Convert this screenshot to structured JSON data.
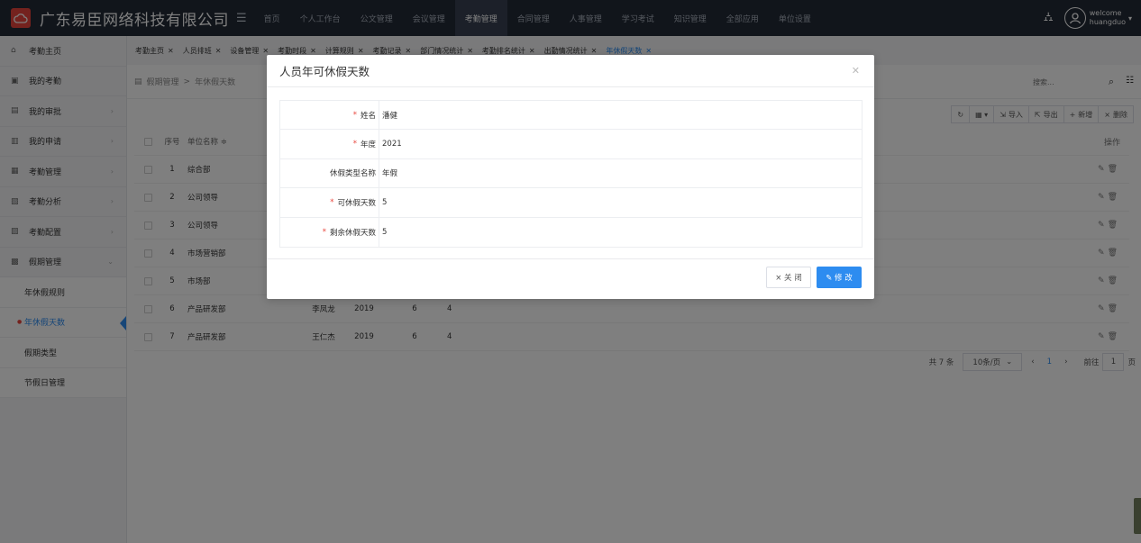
{
  "app": {
    "brand": "广东易臣网络科技有限公司"
  },
  "nav": [
    "首页",
    "个人工作台",
    "公文管理",
    "会议管理",
    "考勤管理",
    "合同管理",
    "人事管理",
    "学习考试",
    "知识管理",
    "全部应用",
    "单位设置"
  ],
  "user": {
    "greeting": "welcome",
    "name": "huangduo"
  },
  "sidebar": {
    "items": [
      {
        "label": "考勤主页",
        "icon": "⌂",
        "arrow": ""
      },
      {
        "label": "我的考勤",
        "icon": "▣",
        "arrow": ""
      },
      {
        "label": "我的审批",
        "icon": "▤",
        "arrow": "›"
      },
      {
        "label": "我的申请",
        "icon": "▥",
        "arrow": "›"
      },
      {
        "label": "考勤管理",
        "icon": "▦",
        "arrow": "›"
      },
      {
        "label": "考勤分析",
        "icon": "▧",
        "arrow": "›"
      },
      {
        "label": "考勤配置",
        "icon": "▨",
        "arrow": "›"
      },
      {
        "label": "假期管理",
        "icon": "▩",
        "arrow": "⌄"
      }
    ],
    "subitems": [
      "年休假规则",
      "年休假天数",
      "假期类型",
      "节假日管理"
    ]
  },
  "tabs": [
    "考勤主页",
    "人员排班",
    "设备管理",
    "考勤时段",
    "计算规则",
    "考勤记录",
    "部门情况统计",
    "考勤排名统计",
    "出勤情况统计",
    "年休假天数"
  ],
  "breadcrumb": {
    "parent": "假期管理",
    "sep": ">",
    "current": "年休假天数"
  },
  "search": {
    "placeholder": "搜索..."
  },
  "toolbar": {
    "import": "导入",
    "export": "导出",
    "add": "新增",
    "delete": "删除"
  },
  "table": {
    "headers": {
      "no": "序号",
      "dept": "单位名称 ≑",
      "op": "操作"
    },
    "rows": [
      {
        "no": "1",
        "dept": "综合部",
        "name": "",
        "year": "",
        "days": "",
        "remain": ""
      },
      {
        "no": "2",
        "dept": "公司领导",
        "name": "",
        "year": "",
        "days": "",
        "remain": ""
      },
      {
        "no": "3",
        "dept": "公司领导",
        "name": "",
        "year": "",
        "days": "",
        "remain": ""
      },
      {
        "no": "4",
        "dept": "市场营销部",
        "name": "",
        "year": "",
        "days": "",
        "remain": ""
      },
      {
        "no": "5",
        "dept": "市场部",
        "name": "",
        "year": "",
        "days": "",
        "remain": ""
      },
      {
        "no": "6",
        "dept": "产品研发部",
        "name": "李凤龙",
        "year": "2019",
        "days": "6",
        "remain": "4"
      },
      {
        "no": "7",
        "dept": "产品研发部",
        "name": "王仁杰",
        "year": "2019",
        "days": "6",
        "remain": "4"
      }
    ]
  },
  "pager": {
    "total": "共 7 条",
    "size": "10条/页",
    "current": "1",
    "goto": "前往",
    "page": "1",
    "unit": "页"
  },
  "modal": {
    "title": "人员年可休假天数",
    "fields": [
      {
        "label": "姓名",
        "required": true,
        "value": "潘健"
      },
      {
        "label": "年度",
        "required": true,
        "value": "2021"
      },
      {
        "label": "休假类型名称",
        "required": false,
        "value": "年假"
      },
      {
        "label": "可休假天数",
        "required": true,
        "value": "5"
      },
      {
        "label": "剩余休假天数",
        "required": true,
        "value": "5"
      }
    ],
    "close_label": "× 关 闭",
    "edit_label": "✎ 修 改"
  }
}
